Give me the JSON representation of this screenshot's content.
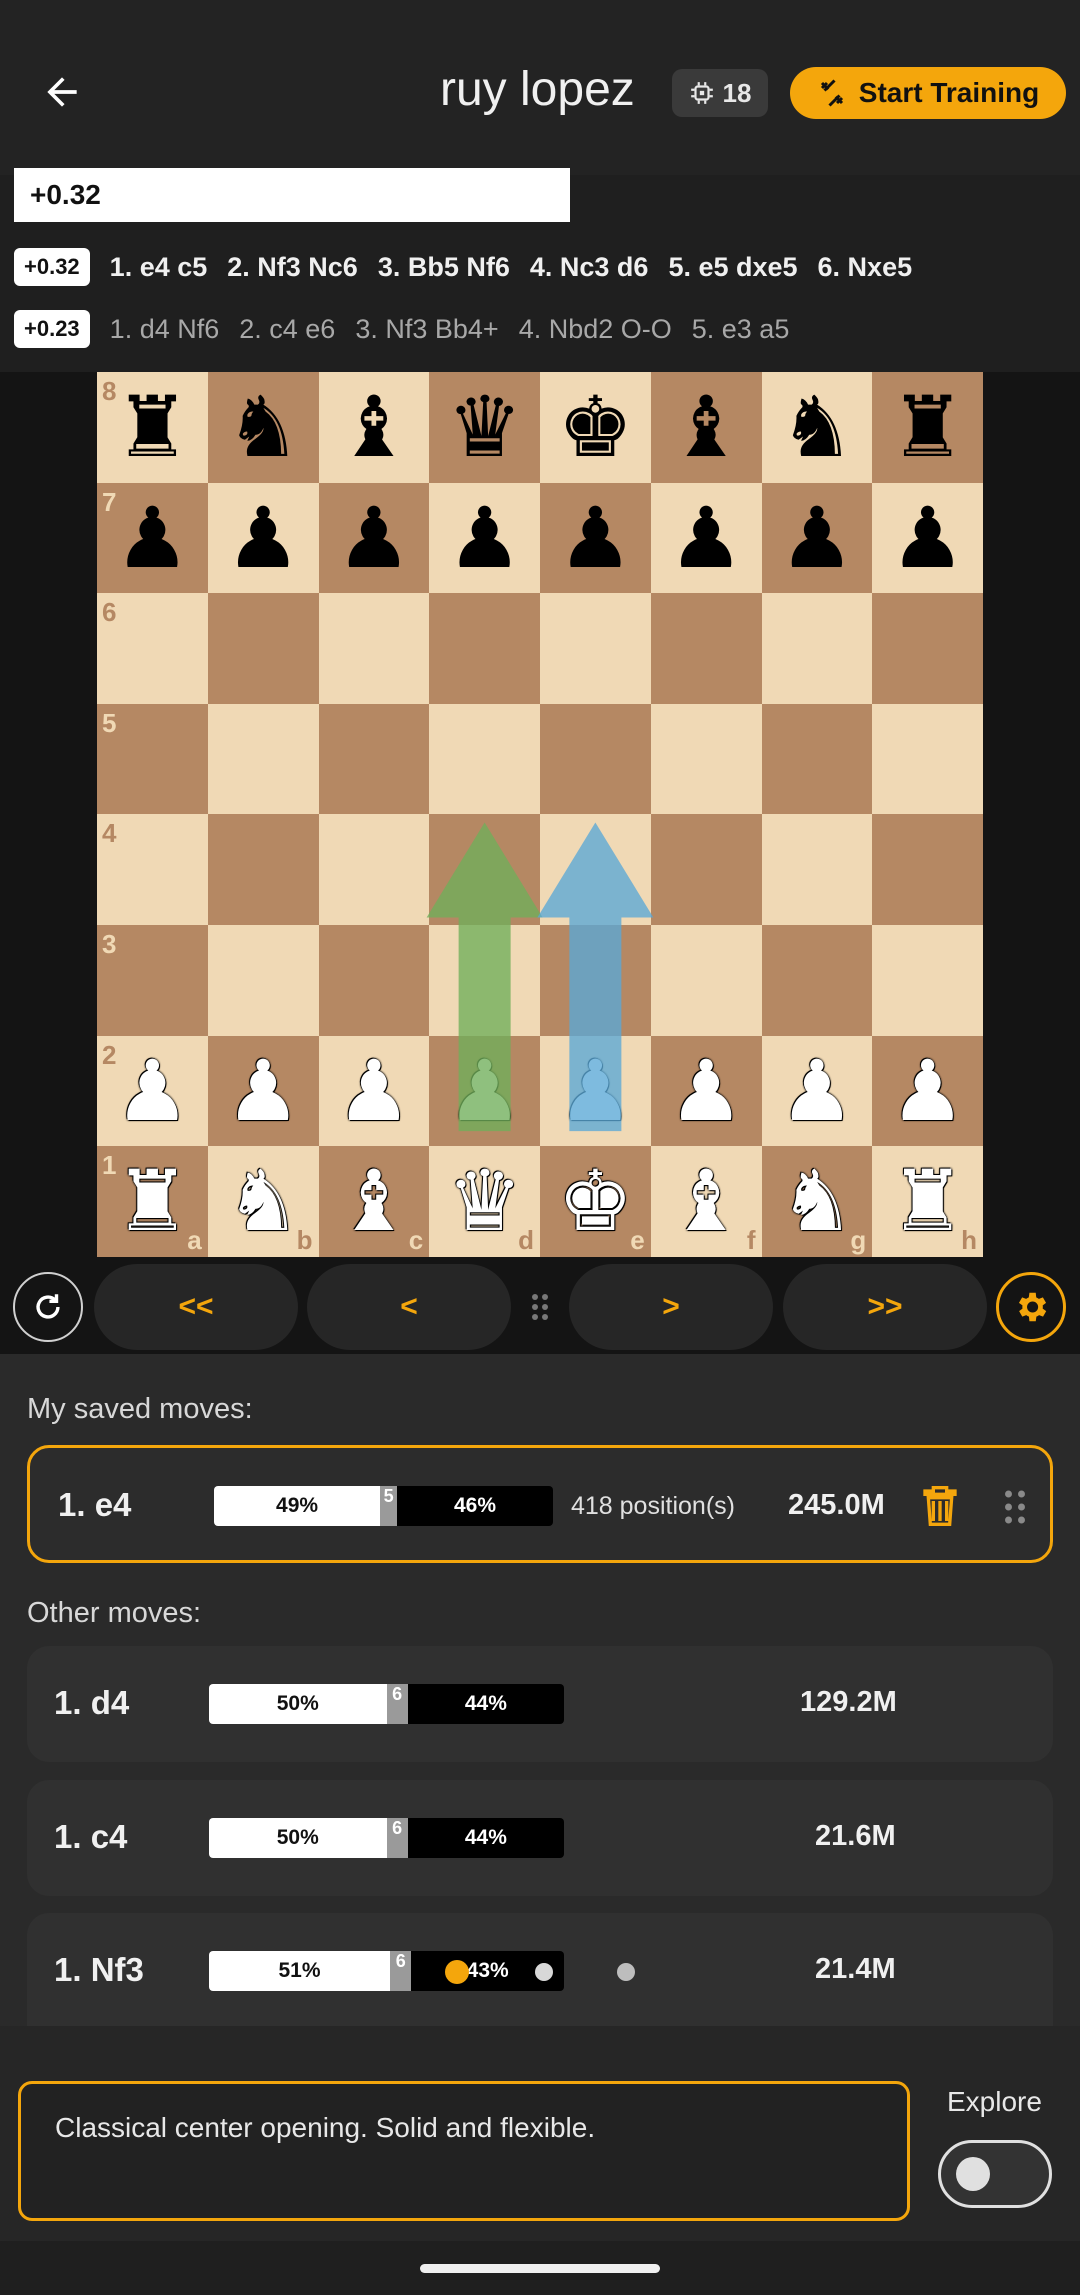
{
  "header": {
    "title": "ruy lopez",
    "engine_depth": "18",
    "train_label": "Start Training"
  },
  "eval": {
    "value": "+0.32"
  },
  "lines": [
    {
      "score": "+0.32",
      "moves": [
        "1. e4 c5",
        "2. Nf3 Nc6",
        "3. Bb5 Nf6",
        "4. Nc3 d6",
        "5. e5 dxe5",
        "6. Nxe5"
      ]
    },
    {
      "score": "+0.23",
      "moves": [
        "1. d4 Nf6",
        "2. c4 e6",
        "3. Nf3 Bb4+",
        "4. Nbd2 O-O",
        "5. e3 a5"
      ]
    }
  ],
  "board": {
    "files": [
      "a",
      "b",
      "c",
      "d",
      "e",
      "f",
      "g",
      "h"
    ],
    "ranks": [
      "8",
      "7",
      "6",
      "5",
      "4",
      "3",
      "2",
      "1"
    ],
    "position": [
      [
        "r",
        "n",
        "b",
        "q",
        "k",
        "b",
        "n",
        "r"
      ],
      [
        "p",
        "p",
        "p",
        "p",
        "p",
        "p",
        "p",
        "p"
      ],
      [
        "",
        "",
        "",
        "",
        "",
        "",
        "",
        ""
      ],
      [
        "",
        "",
        "",
        "",
        "",
        "",
        "",
        ""
      ],
      [
        "",
        "",
        "",
        "",
        "",
        "",
        "",
        ""
      ],
      [
        "",
        "",
        "",
        "",
        "",
        "",
        "",
        ""
      ],
      [
        "P",
        "P",
        "P",
        "P",
        "P",
        "P",
        "P",
        "P"
      ],
      [
        "R",
        "N",
        "B",
        "Q",
        "K",
        "B",
        "N",
        "R"
      ]
    ],
    "arrows": [
      {
        "from": "d2",
        "to": "d4",
        "color": "#6fae5a"
      },
      {
        "from": "e2",
        "to": "e4",
        "color": "#5aa8d6"
      }
    ]
  },
  "nav": {
    "first": "<<",
    "prev": "<",
    "next": ">",
    "last": ">>"
  },
  "saved": {
    "label": "My saved moves:",
    "items": [
      {
        "move": "1. e4",
        "white": "49%",
        "draw": "5",
        "black": "46%",
        "white_frac": 0.49,
        "draw_frac": 0.05,
        "black_frac": 0.46,
        "positions": "418 position(s)",
        "games": "245.0M"
      }
    ]
  },
  "other": {
    "label": "Other moves:",
    "items": [
      {
        "move": "1. d4",
        "white": "50%",
        "draw": "6",
        "black": "44%",
        "white_frac": 0.5,
        "draw_frac": 0.06,
        "black_frac": 0.44,
        "games": "129.2M"
      },
      {
        "move": "1. c4",
        "white": "50%",
        "draw": "6",
        "black": "44%",
        "white_frac": 0.5,
        "draw_frac": 0.06,
        "black_frac": 0.44,
        "games": "21.6M"
      },
      {
        "move": "1. Nf3",
        "white": "51%",
        "draw": "6",
        "black": "43%",
        "white_frac": 0.51,
        "draw_frac": 0.06,
        "black_frac": 0.43,
        "games": "21.4M"
      }
    ]
  },
  "comment": {
    "text": "Classical center opening. Solid and flexible."
  },
  "explore": {
    "label": "Explore",
    "enabled": false
  },
  "colors": {
    "accent": "#f4a60c",
    "light_square": "#f0d9b5",
    "dark_square": "#b58863"
  }
}
